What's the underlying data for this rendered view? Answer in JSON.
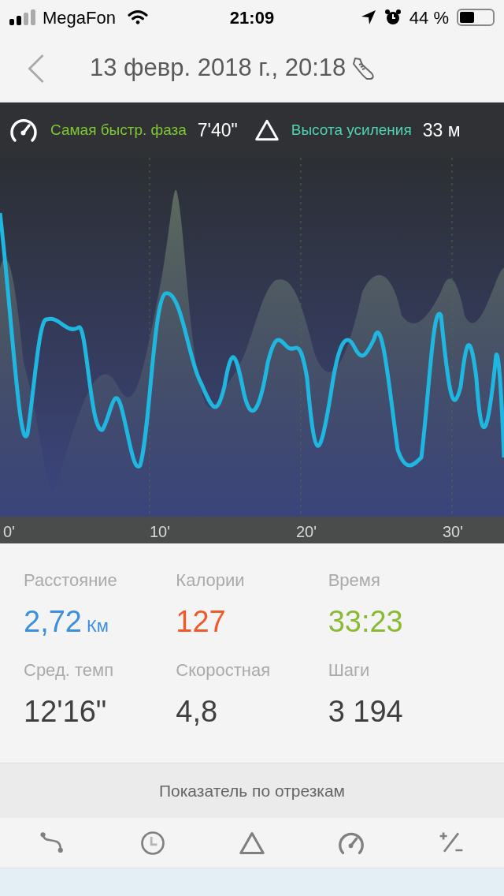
{
  "status_bar": {
    "carrier": "MegaFon",
    "time": "21:09",
    "battery": "44 %"
  },
  "header": {
    "title": "13 февр. 2018 г., 20:18"
  },
  "chart_summary": [
    {
      "kind": "speed",
      "label": "Самая быстр. фаза",
      "value": "7'40\"",
      "color": "#7ec832"
    },
    {
      "kind": "elevation",
      "label": "Высота усиления",
      "value": "33 м",
      "color": "#4fd3b4"
    }
  ],
  "x_ticks": [
    "0'",
    "10'",
    "20'",
    "30'"
  ],
  "stats": [
    {
      "label": "Расстояние",
      "value": "2,72",
      "unit": "Км",
      "color": "#3b8fe0"
    },
    {
      "label": "Калории",
      "value": "127",
      "color": "#f05a28"
    },
    {
      "label": "Время",
      "value": "33:23",
      "color": "#8ab933"
    },
    {
      "label": "Сред. темп",
      "value": "12'16\"",
      "color": "#3f3f3f"
    },
    {
      "label": "Скоростная",
      "value": "4,8",
      "color": "#3f3f3f"
    },
    {
      "label": "Шаги",
      "value": "3 194",
      "color": "#3f3f3f"
    }
  ],
  "segments_title": "Показатель по отрезкам",
  "segment_tabs": [
    {
      "kind": "route",
      "selected": false
    },
    {
      "kind": "time",
      "selected": false
    },
    {
      "kind": "elevation",
      "selected": false
    },
    {
      "kind": "speed",
      "selected": false
    },
    {
      "kind": "plusminus",
      "selected": false
    }
  ]
}
